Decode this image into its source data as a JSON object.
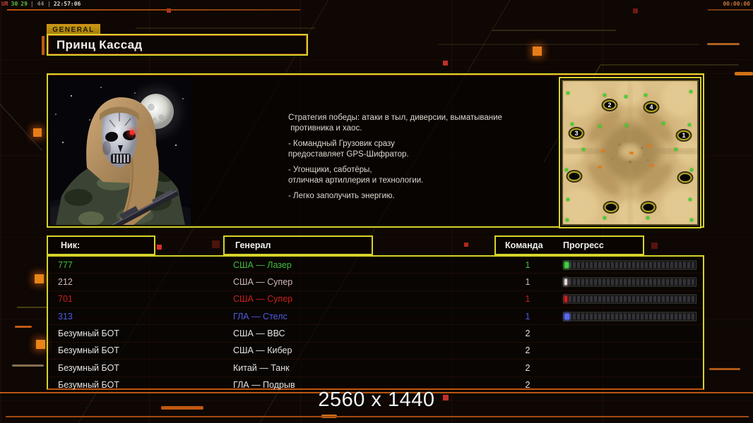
{
  "hud": {
    "top_left_segments": [
      {
        "text": "UR",
        "color": "#c84030"
      },
      {
        "text": "30",
        "color": "#58c040"
      },
      {
        "text": "29",
        "color": "#58c040"
      },
      {
        "text": "| 44 |",
        "color": "#8a8a82"
      },
      {
        "text": "22:57:06",
        "color": "#d8d8cc"
      }
    ],
    "top_right_timer": "00:00:00"
  },
  "general_panel": {
    "tab_label": "GENERAL",
    "title": "Принц Кассад",
    "strategy_lines": [
      "Стратегия победы: атаки в тыл, диверсии, выматывание",
      " противника и хаос.",
      "",
      "- Командный Грузовик сразу",
      "предоставляет GPS-Шифратор.",
      "",
      "- Угонщики, саботёры,",
      "отличная артиллерия и технологии.",
      "",
      "- Легко заполучить энергию."
    ],
    "minimap": {
      "numbered_spots": [
        "1",
        "2",
        "3",
        "4"
      ]
    }
  },
  "table": {
    "headers": {
      "nick": "Ник:",
      "general": "Генерал",
      "team": "Команда",
      "progress": "Прогресс"
    },
    "rows": [
      {
        "nick": "777",
        "general": "США — Лазер",
        "team": "1",
        "color": "#3fbf3f",
        "bar": {
          "pct": 3,
          "color": "#3fd040"
        }
      },
      {
        "nick": "212",
        "general": "США — Супер",
        "team": "1",
        "color": "#cfb8b8",
        "bar": {
          "pct": 2,
          "color": "#e8d6d6"
        }
      },
      {
        "nick": "701",
        "general": "США — Супер",
        "team": "1",
        "color": "#cc1f1f",
        "bar": {
          "pct": 2,
          "color": "#d02020"
        }
      },
      {
        "nick": "313",
        "general": "ГЛА — Стелс",
        "team": "1",
        "color": "#4a5cdd",
        "bar": {
          "pct": 4,
          "color": "#5868f0"
        }
      },
      {
        "nick": "Безумный БОТ",
        "general": "США — ВВС",
        "team": "2",
        "color": "#e4e4e4",
        "bar": null
      },
      {
        "nick": "Безумный БОТ",
        "general": "США — Кибер",
        "team": "2",
        "color": "#e4e4e4",
        "bar": null
      },
      {
        "nick": "Безумный БОТ",
        "general": "Китай — Танк",
        "team": "2",
        "color": "#e4e4e4",
        "bar": null
      },
      {
        "nick": "Безумный БОТ",
        "general": "ГЛА — Подрыв",
        "team": "2",
        "color": "#e4e4e4",
        "bar": null
      }
    ]
  },
  "footer": {
    "resolution": "2560 x 1440"
  }
}
